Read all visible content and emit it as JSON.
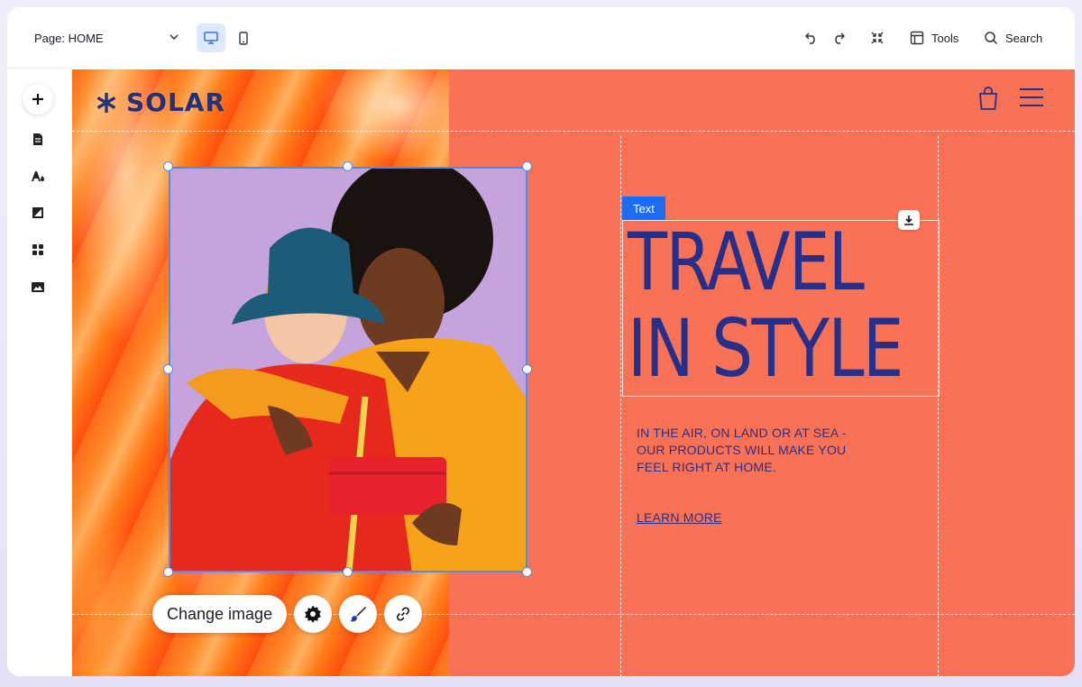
{
  "topbar": {
    "page_label": "Page: HOME",
    "tools_label": "Tools",
    "search_label": "Search"
  },
  "site": {
    "logo_text": "SOLAR",
    "headline": [
      "TRAVEL",
      "IN STYLE"
    ],
    "body_copy": "IN THE AIR, ON LAND OR AT SEA - OUR PRODUCTS WILL MAKE YOU FEEL RIGHT AT HOME.",
    "link_label": "LEARN MORE"
  },
  "selection": {
    "text_tag": "Text",
    "change_image_label": "Change image"
  },
  "colors": {
    "accent": "#1c6df2",
    "brand_blue": "#26308a",
    "canvas_bg": "#f97256",
    "selection": "#4b8df2"
  },
  "icons": {
    "rail": [
      "add-icon",
      "pages-icon",
      "theme-icon",
      "section-icon",
      "apps-icon",
      "media-icon"
    ],
    "toolbar": [
      "settings-icon",
      "design-icon",
      "link-icon"
    ]
  }
}
